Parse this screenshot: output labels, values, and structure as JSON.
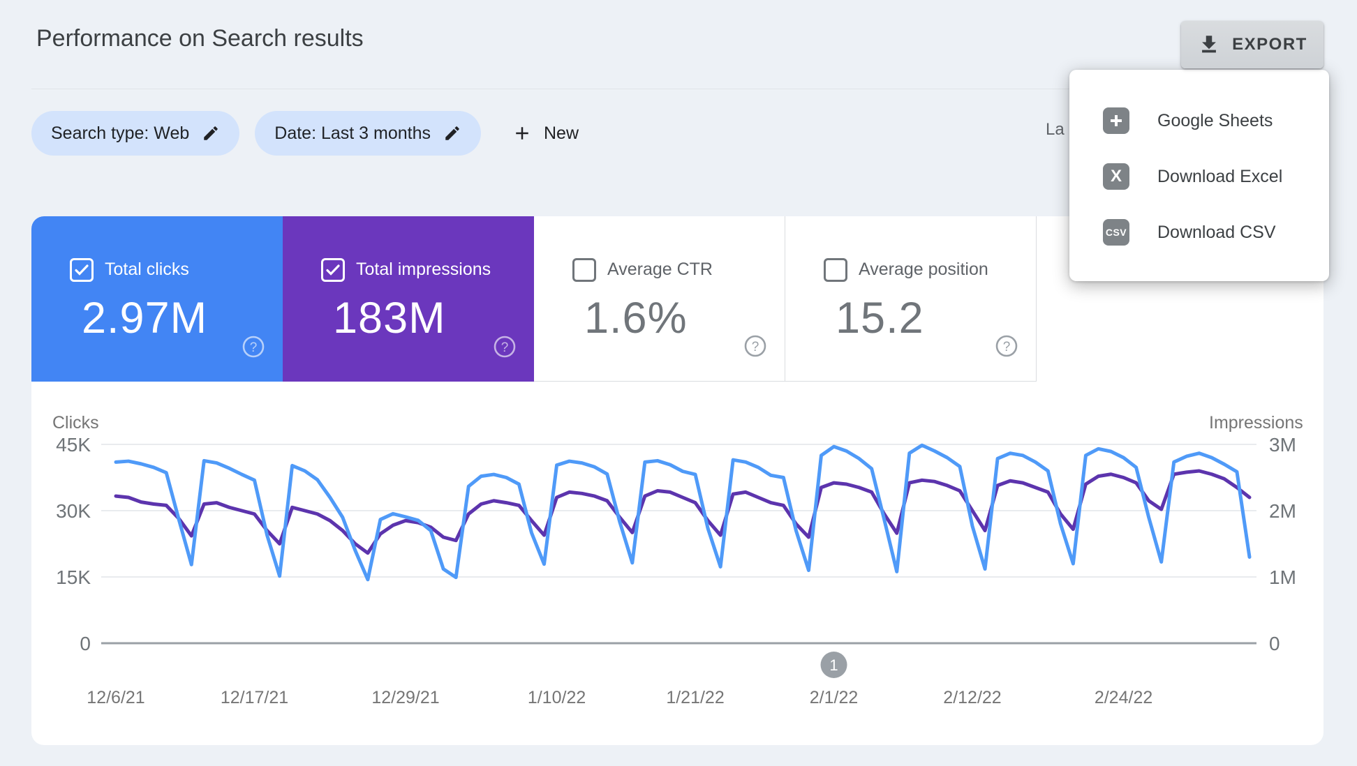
{
  "header": {
    "title": "Performance on Search results",
    "export_label": "EXPORT",
    "last_updated_truncated": "La"
  },
  "filters": {
    "search_type_chip": "Search type: Web",
    "date_chip": "Date: Last 3 months",
    "new_button": "New"
  },
  "export_menu": {
    "items": [
      {
        "label": "Google Sheets",
        "icon": "sheets-icon"
      },
      {
        "label": "Download Excel",
        "icon": "excel-icon",
        "glyph": "X"
      },
      {
        "label": "Download CSV",
        "icon": "csv-icon",
        "glyph": "CSV"
      }
    ]
  },
  "metric_cards": [
    {
      "label": "Total clicks",
      "value": "2.97M",
      "checked": true,
      "color": "#4285f4"
    },
    {
      "label": "Total impressions",
      "value": "183M",
      "checked": true,
      "color": "#6b37bd"
    },
    {
      "label": "Average CTR",
      "value": "1.6%",
      "checked": false
    },
    {
      "label": "Average position",
      "value": "15.2",
      "checked": false
    }
  ],
  "chart_data": {
    "type": "line",
    "left_axis": {
      "title": "Clicks",
      "tick_labels": [
        "45K",
        "30K",
        "15K",
        "0"
      ],
      "tick_values": [
        45000,
        30000,
        15000,
        0
      ],
      "max": 45000
    },
    "right_axis": {
      "title": "Impressions",
      "tick_labels": [
        "3M",
        "2M",
        "1M",
        "0"
      ],
      "tick_values": [
        3000000,
        2000000,
        1000000,
        0
      ],
      "max": 3000000
    },
    "grid": true,
    "legend_position": "none",
    "x_tick_indices": [
      0,
      11,
      23,
      35,
      46,
      57,
      68,
      80
    ],
    "x_tick_labels": [
      "12/6/21",
      "12/17/21",
      "12/29/21",
      "1/10/22",
      "1/21/22",
      "2/1/22",
      "2/12/22",
      "2/24/22"
    ],
    "marker": {
      "x_index": 57,
      "label": "1"
    },
    "dates": [
      "12/6/21",
      "12/7/21",
      "12/8/21",
      "12/9/21",
      "12/10/21",
      "12/11/21",
      "12/12/21",
      "12/13/21",
      "12/14/21",
      "12/15/21",
      "12/16/21",
      "12/17/21",
      "12/18/21",
      "12/19/21",
      "12/20/21",
      "12/21/21",
      "12/22/21",
      "12/23/21",
      "12/24/21",
      "12/25/21",
      "12/26/21",
      "12/27/21",
      "12/28/21",
      "12/29/21",
      "12/30/21",
      "12/31/21",
      "1/1/22",
      "1/2/22",
      "1/3/22",
      "1/4/22",
      "1/5/22",
      "1/6/22",
      "1/7/22",
      "1/8/22",
      "1/9/22",
      "1/10/22",
      "1/11/22",
      "1/12/22",
      "1/13/22",
      "1/14/22",
      "1/15/22",
      "1/16/22",
      "1/17/22",
      "1/18/22",
      "1/19/22",
      "1/20/22",
      "1/21/22",
      "1/22/22",
      "1/23/22",
      "1/24/22",
      "1/25/22",
      "1/26/22",
      "1/27/22",
      "1/28/22",
      "1/29/22",
      "1/30/22",
      "1/31/22",
      "2/1/22",
      "2/2/22",
      "2/3/22",
      "2/4/22",
      "2/5/22",
      "2/6/22",
      "2/7/22",
      "2/8/22",
      "2/9/22",
      "2/10/22",
      "2/11/22",
      "2/12/22",
      "2/13/22",
      "2/14/22",
      "2/15/22",
      "2/16/22",
      "2/17/22",
      "2/18/22",
      "2/19/22",
      "2/20/22",
      "2/21/22",
      "2/22/22",
      "2/23/22",
      "2/24/22",
      "2/25/22",
      "2/26/22",
      "2/27/22",
      "2/28/22",
      "3/1/22",
      "3/2/22",
      "3/3/22",
      "3/4/22",
      "3/5/22",
      "3/6/22"
    ],
    "series": [
      {
        "name": "Total clicks",
        "axis": "left",
        "color": "#4f9af8",
        "values": [
          41000,
          41200,
          40600,
          39800,
          38600,
          28000,
          17800,
          41300,
          40800,
          39600,
          38200,
          36900,
          24500,
          15200,
          40200,
          39000,
          37000,
          33000,
          28500,
          21000,
          14400,
          28000,
          29300,
          28600,
          27800,
          25500,
          16800,
          14900,
          35500,
          37800,
          38200,
          37500,
          36000,
          25000,
          17900,
          40300,
          41200,
          40800,
          39900,
          38300,
          27500,
          18200,
          41000,
          41300,
          40400,
          38900,
          38200,
          26000,
          17300,
          41500,
          41000,
          39800,
          38000,
          37500,
          25500,
          16500,
          42500,
          44500,
          43500,
          41800,
          39500,
          28000,
          16200,
          43000,
          44800,
          43500,
          42000,
          40000,
          26500,
          16800,
          41800,
          43000,
          42500,
          41000,
          39000,
          27000,
          18000,
          42500,
          44000,
          43400,
          42000,
          39800,
          28500,
          18400,
          41000,
          42300,
          43000,
          42000,
          40500,
          38800,
          19500
        ]
      },
      {
        "name": "Total impressions",
        "axis": "right",
        "color": "#5c34ad",
        "values": [
          2220000,
          2200000,
          2130000,
          2100000,
          2080000,
          1880000,
          1620000,
          2100000,
          2120000,
          2050000,
          2000000,
          1950000,
          1700000,
          1500000,
          2050000,
          2000000,
          1950000,
          1850000,
          1700000,
          1500000,
          1360000,
          1650000,
          1780000,
          1850000,
          1820000,
          1750000,
          1600000,
          1550000,
          1950000,
          2100000,
          2150000,
          2120000,
          2080000,
          1850000,
          1630000,
          2200000,
          2280000,
          2260000,
          2220000,
          2150000,
          1900000,
          1670000,
          2220000,
          2300000,
          2280000,
          2200000,
          2120000,
          1850000,
          1630000,
          2250000,
          2280000,
          2200000,
          2120000,
          2080000,
          1800000,
          1600000,
          2350000,
          2420000,
          2400000,
          2350000,
          2280000,
          1950000,
          1660000,
          2420000,
          2460000,
          2440000,
          2380000,
          2300000,
          2000000,
          1700000,
          2380000,
          2450000,
          2420000,
          2350000,
          2280000,
          1950000,
          1720000,
          2400000,
          2520000,
          2550000,
          2500000,
          2420000,
          2150000,
          2020000,
          2550000,
          2580000,
          2600000,
          2550000,
          2480000,
          2350000,
          2200000
        ]
      }
    ]
  }
}
